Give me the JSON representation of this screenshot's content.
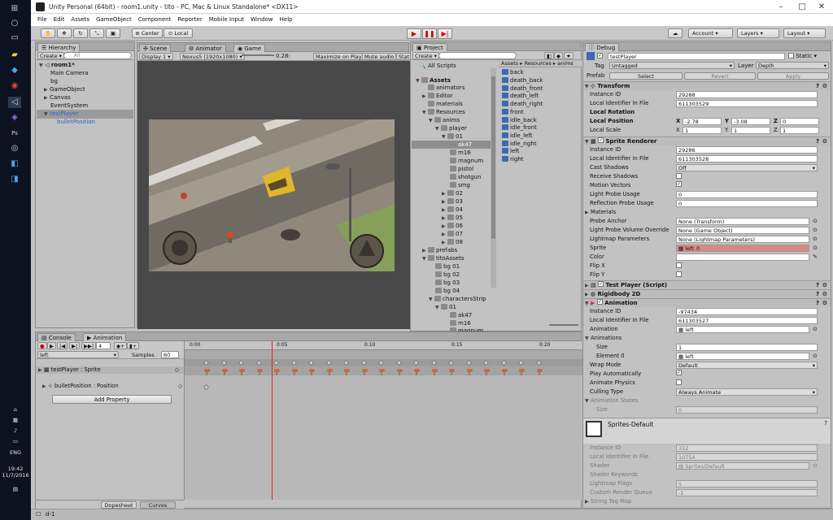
{
  "window": {
    "title": "Unity Personal (64bit) - room1.unity - tito - PC, Mac & Linux Standalone* <DX11>"
  },
  "menu": [
    "File",
    "Edit",
    "Assets",
    "GameObject",
    "Component",
    "Reporter",
    "Mobile Input",
    "Window",
    "Help"
  ],
  "toolbar": {
    "center": "Center",
    "local": "Local",
    "account": "Account",
    "layers": "Layers",
    "layout": "Layout"
  },
  "taskbar": {
    "time": "19:42",
    "date": "11/7/2016",
    "lang": "ENG"
  },
  "hierarchy": {
    "tab": "Hierarchy",
    "create": "Create",
    "search": "All",
    "scene": "room1*",
    "items": [
      "Main Camera",
      "bg",
      "GameObject",
      "Canvas",
      "EventSystem",
      "testPlayer",
      "bulletPosition"
    ]
  },
  "scene_tabs": {
    "scene": "Scene",
    "animator": "Animator",
    "game": "Game"
  },
  "game": {
    "display": "Display 1",
    "resolution": "Nexus5 (1920x1080)",
    "scale_label": "Scale",
    "scale": "0.28:",
    "maximize": "Maximize on Play",
    "mute": "Mute audio",
    "stats": "Stat"
  },
  "project": {
    "tab": "Project",
    "create": "Create",
    "all_scripts": "All Scripts",
    "breadcrumb": [
      "Assets",
      "Resources",
      "anims"
    ],
    "tree": [
      "Assets",
      "animators",
      "Editor",
      "materials",
      "Resources",
      "anims",
      "player",
      "01",
      "ak47",
      "m16",
      "magnum",
      "pistol",
      "shotgun",
      "smg",
      "02",
      "03",
      "04",
      "05",
      "06",
      "07",
      "08",
      "prefabs",
      "titoAssets",
      "bg 01",
      "bg 02",
      "bg 03",
      "bg 04",
      "charactersStrip",
      "01",
      "ak47",
      "m16",
      "magnum"
    ],
    "files": [
      "back",
      "death_back",
      "death_front",
      "death_left",
      "death_right",
      "front",
      "idle_back",
      "idle_front",
      "idle_left",
      "idle_right",
      "left",
      "right"
    ]
  },
  "inspector": {
    "tab": "Debug",
    "object": "testPlayer",
    "static": "Static",
    "tag_label": "Tag",
    "tag": "Untagged",
    "layer_label": "Layer",
    "layer": "Depth",
    "prefab": "Prefab",
    "select": "Select",
    "revert": "Revert",
    "apply": "Apply",
    "transform": {
      "title": "Transform",
      "instance_id_label": "Instance ID",
      "instance_id": "29288",
      "lid_label": "Local Identifier In File",
      "lid": "611303529",
      "rot_label": "Local Rotation",
      "pos_label": "Local Position",
      "pos_x": "-2.78",
      "pos_y": "-3.08",
      "pos_z": "0",
      "scale_label": "Local Scale",
      "scale_x": "1",
      "scale_y": "1",
      "scale_z": "1"
    },
    "sprite_renderer": {
      "title": "Sprite Renderer",
      "instance_id": "29286",
      "lid": "611303528",
      "cast_shadows_label": "Cast Shadows",
      "cast_shadows": "Off",
      "receive_shadows": "Receive Shadows",
      "motion_vectors": "Motion Vectors",
      "light_probe_label": "Light Probe Usage",
      "light_probe": "0",
      "refl_probe_label": "Reflection Probe Usage",
      "refl_probe": "0",
      "materials": "Materials",
      "probe_anchor_label": "Probe Anchor",
      "probe_anchor": "None (Transform)",
      "lpvo_label": "Light Probe Volume Override",
      "lpvo": "None (Game Object)",
      "lightmap_params_label": "Lightmap Parameters",
      "lightmap_params": "None (Lightmap Parameters)",
      "sprite_label": "Sprite",
      "sprite": "left_0",
      "color_label": "Color",
      "flipx": "Flip X",
      "flipy": "Flip Y"
    },
    "script": {
      "title": "Test Player (Script)"
    },
    "rigidbody": {
      "title": "Rigidbody 2D"
    },
    "animation": {
      "title": "Animation",
      "instance_id": "-97434",
      "lid": "611303527",
      "anim_label": "Animation",
      "anim": "left",
      "animations_label": "Animations",
      "size_label": "Size",
      "size": "1",
      "element_label": "Element 0",
      "element": "left",
      "wrap_label": "Wrap Mode",
      "wrap": "Default",
      "play_auto": "Play Automatically",
      "animate_physics": "Animate Physics",
      "culling_label": "Culling Type",
      "culling": "Always Animate",
      "states_label": "Animation States",
      "states_size": "0"
    },
    "material": {
      "name": "Sprites-Default",
      "instance_id": "312",
      "lid": "10754",
      "shader_label": "Shader",
      "shader": "Sprites/Default",
      "keywords": "Shader Keywords",
      "lightmap_flags_label": "Lightmap Flags",
      "lightmap_flags": "5",
      "rq_label": "Custom Render Queue",
      "rq": "-1",
      "tag_map": "String Tag Map"
    }
  },
  "animation_panel": {
    "console_tab": "Console",
    "animation_tab": "Animation",
    "clip": "left",
    "samples_label": "Samples",
    "samples": "60",
    "frame": "4",
    "ticks": [
      "0:00",
      "0:05",
      "0:10",
      "0:15",
      "0:20"
    ],
    "tracks": [
      "testPlayer : Sprite",
      "bulletPosition : Position"
    ],
    "add_property": "Add Property",
    "dopesheet": "Dopesheet",
    "curves": "Curves"
  },
  "status": {
    "text": "d-1"
  }
}
